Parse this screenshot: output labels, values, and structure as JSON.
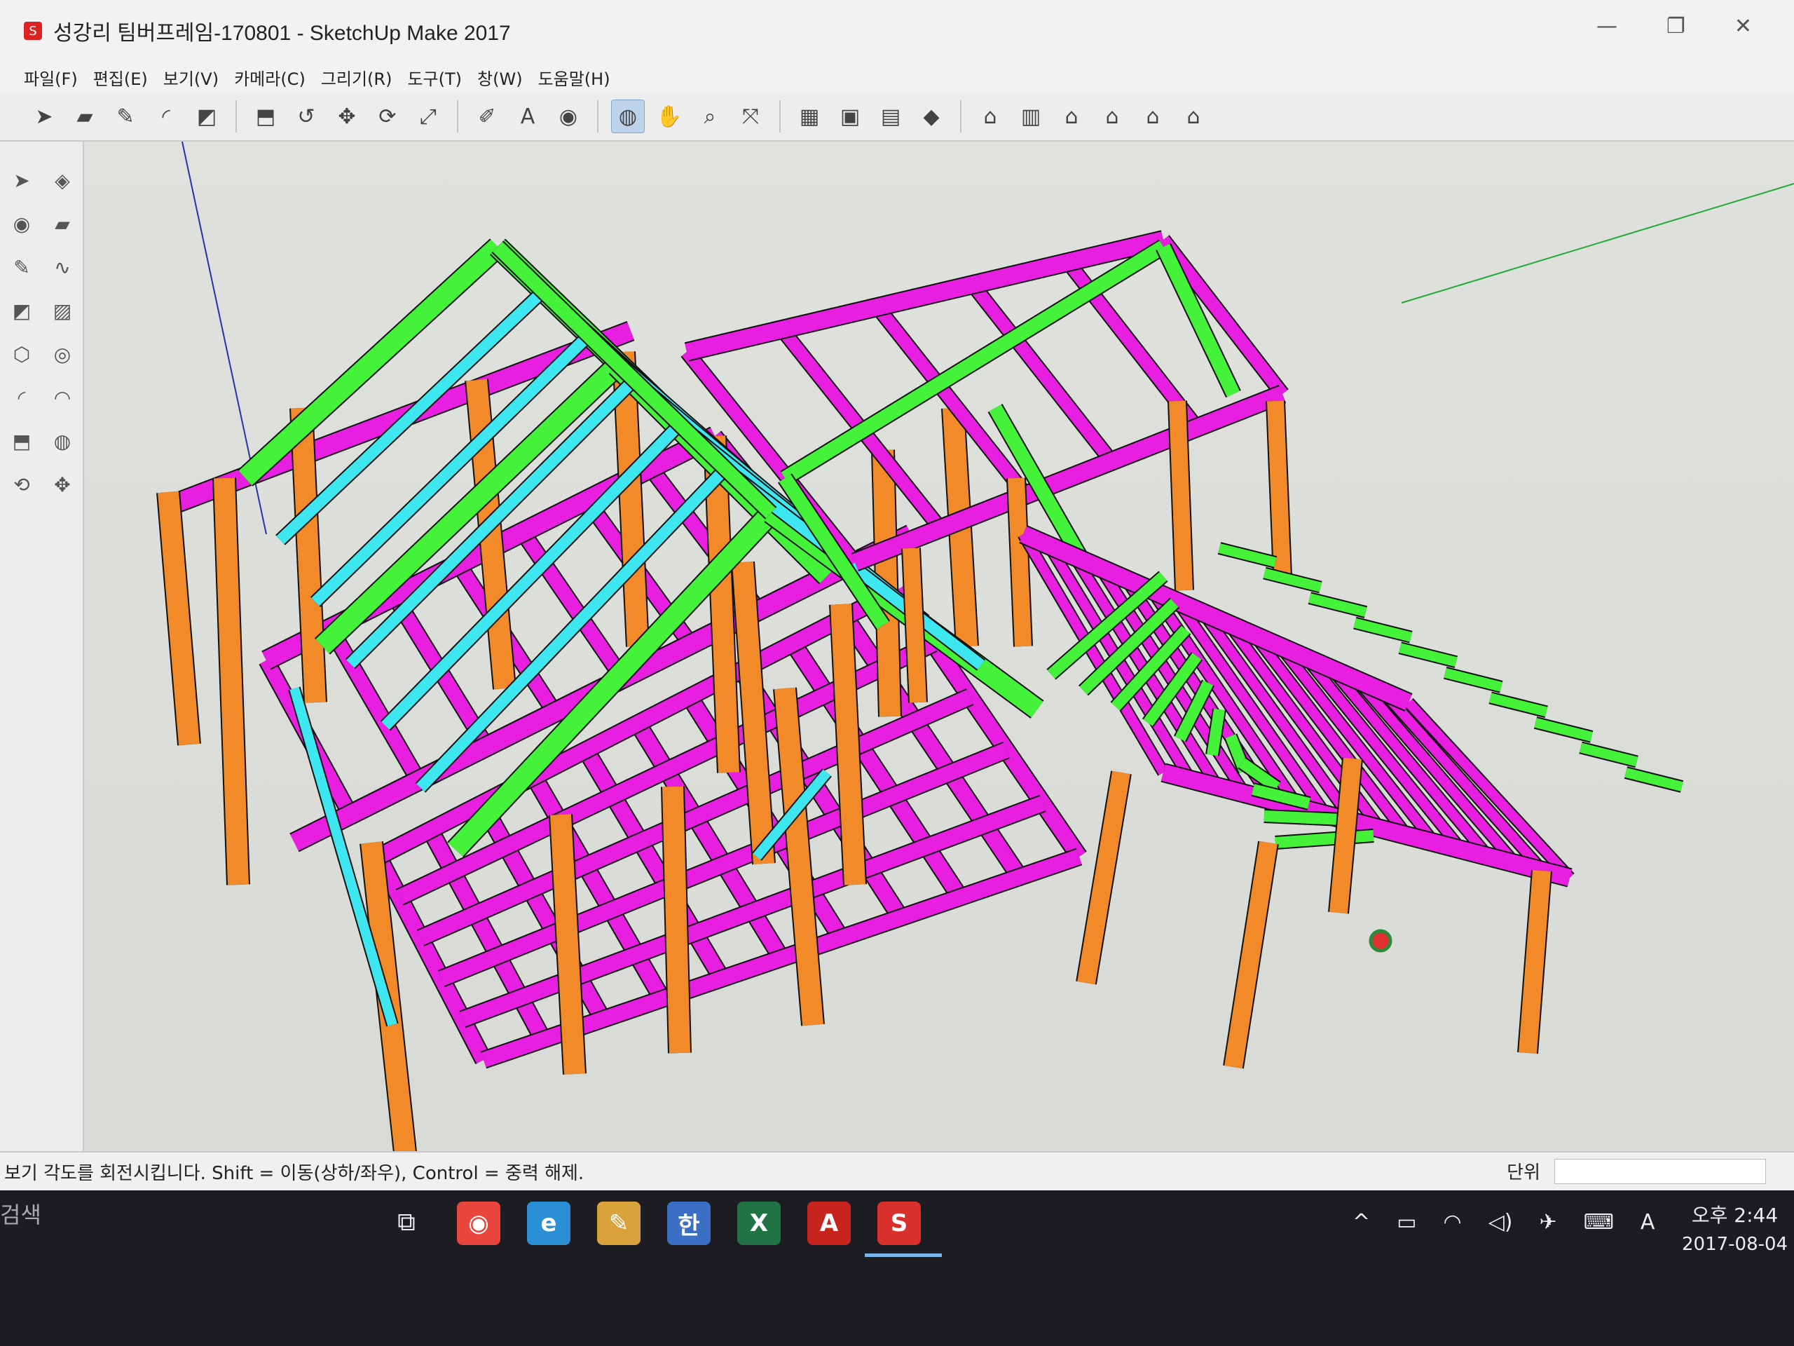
{
  "window": {
    "title": "성강리 팀버프레임-170801 - SketchUp Make 2017",
    "controls": [
      "—",
      "❐",
      "✕"
    ]
  },
  "menu": [
    "파일(F)",
    "편집(E)",
    "보기(V)",
    "카메라(C)",
    "그리기(R)",
    "도구(T)",
    "창(W)",
    "도움말(H)"
  ],
  "toolbar": {
    "tools": [
      {
        "name": "select-tool",
        "glyph": "➤"
      },
      {
        "name": "eraser-tool",
        "glyph": "▰"
      },
      {
        "name": "pencil-line-tool",
        "glyph": "✎"
      },
      {
        "name": "arc-tool",
        "glyph": "◜"
      },
      {
        "name": "rectangle-tool",
        "glyph": "◩"
      },
      {
        "name": "push-pull-tool",
        "glyph": "⬒"
      },
      {
        "name": "offset-tool",
        "glyph": "↺"
      },
      {
        "name": "move-tool",
        "glyph": "✥"
      },
      {
        "name": "rotate-tool",
        "glyph": "⟳"
      },
      {
        "name": "scale-tool",
        "glyph": "⤢"
      },
      {
        "name": "tape-measure-tool",
        "glyph": "✐"
      },
      {
        "name": "text-tool",
        "glyph": "A"
      },
      {
        "name": "paint-bucket-tool",
        "glyph": "◉"
      },
      {
        "name": "orbit-tool",
        "glyph": "◍"
      },
      {
        "name": "pan-tool",
        "glyph": "✋"
      },
      {
        "name": "zoom-tool",
        "glyph": "⌕"
      },
      {
        "name": "zoom-extents-tool",
        "glyph": "⤧"
      },
      {
        "name": "warehouse-tool",
        "glyph": "▦"
      },
      {
        "name": "extension-tool",
        "glyph": "▣"
      },
      {
        "name": "layout-tool",
        "glyph": "▤"
      },
      {
        "name": "ruby-tool",
        "glyph": "◆"
      },
      {
        "name": "iso-view",
        "glyph": "⌂"
      },
      {
        "name": "top-view",
        "glyph": "▥"
      },
      {
        "name": "front-view",
        "glyph": "⌂"
      },
      {
        "name": "right-view",
        "glyph": "⌂"
      },
      {
        "name": "back-view",
        "glyph": "⌂"
      },
      {
        "name": "left-view",
        "glyph": "⌂"
      }
    ]
  },
  "lefttools": [
    "➤",
    "◈",
    "◉",
    "▰",
    "✎",
    "∿",
    "◩",
    "▨",
    "⬡",
    "◎",
    "◜",
    "◠",
    "⬒",
    "◍",
    "⟲",
    "✥"
  ],
  "status": {
    "text": "보기 각도를 회전시킵니다. Shift = 이동(상하/좌우), Control = 중력 해제.",
    "unit_label": "단위"
  },
  "taskbar": {
    "search_text": "검색",
    "apps": [
      {
        "name": "chrome-icon",
        "glyph": "◉",
        "color": "#e8453c"
      },
      {
        "name": "internet-explorer-icon",
        "glyph": "e",
        "color": "#2b8fd6"
      },
      {
        "name": "paint-icon",
        "glyph": "✎",
        "color": "#d9a23a"
      },
      {
        "name": "hwp-icon",
        "glyph": "한",
        "color": "#3a6fc4"
      },
      {
        "name": "excel-icon",
        "glyph": "X",
        "color": "#217346"
      },
      {
        "name": "autocad-icon",
        "glyph": "A",
        "color": "#c8241e"
      },
      {
        "name": "sketchup-icon",
        "glyph": "S",
        "color": "#d9302b"
      }
    ],
    "tray": [
      "^",
      "▭",
      "◠",
      "◁)",
      "✈",
      "⌨",
      "A"
    ],
    "time": "오후 2:44",
    "date": "2017-08-04"
  },
  "colors": {
    "post": "#f28a2a",
    "beam": "#e81fe0",
    "rafter": "#44f23a",
    "brace": "#3ee6f0"
  }
}
